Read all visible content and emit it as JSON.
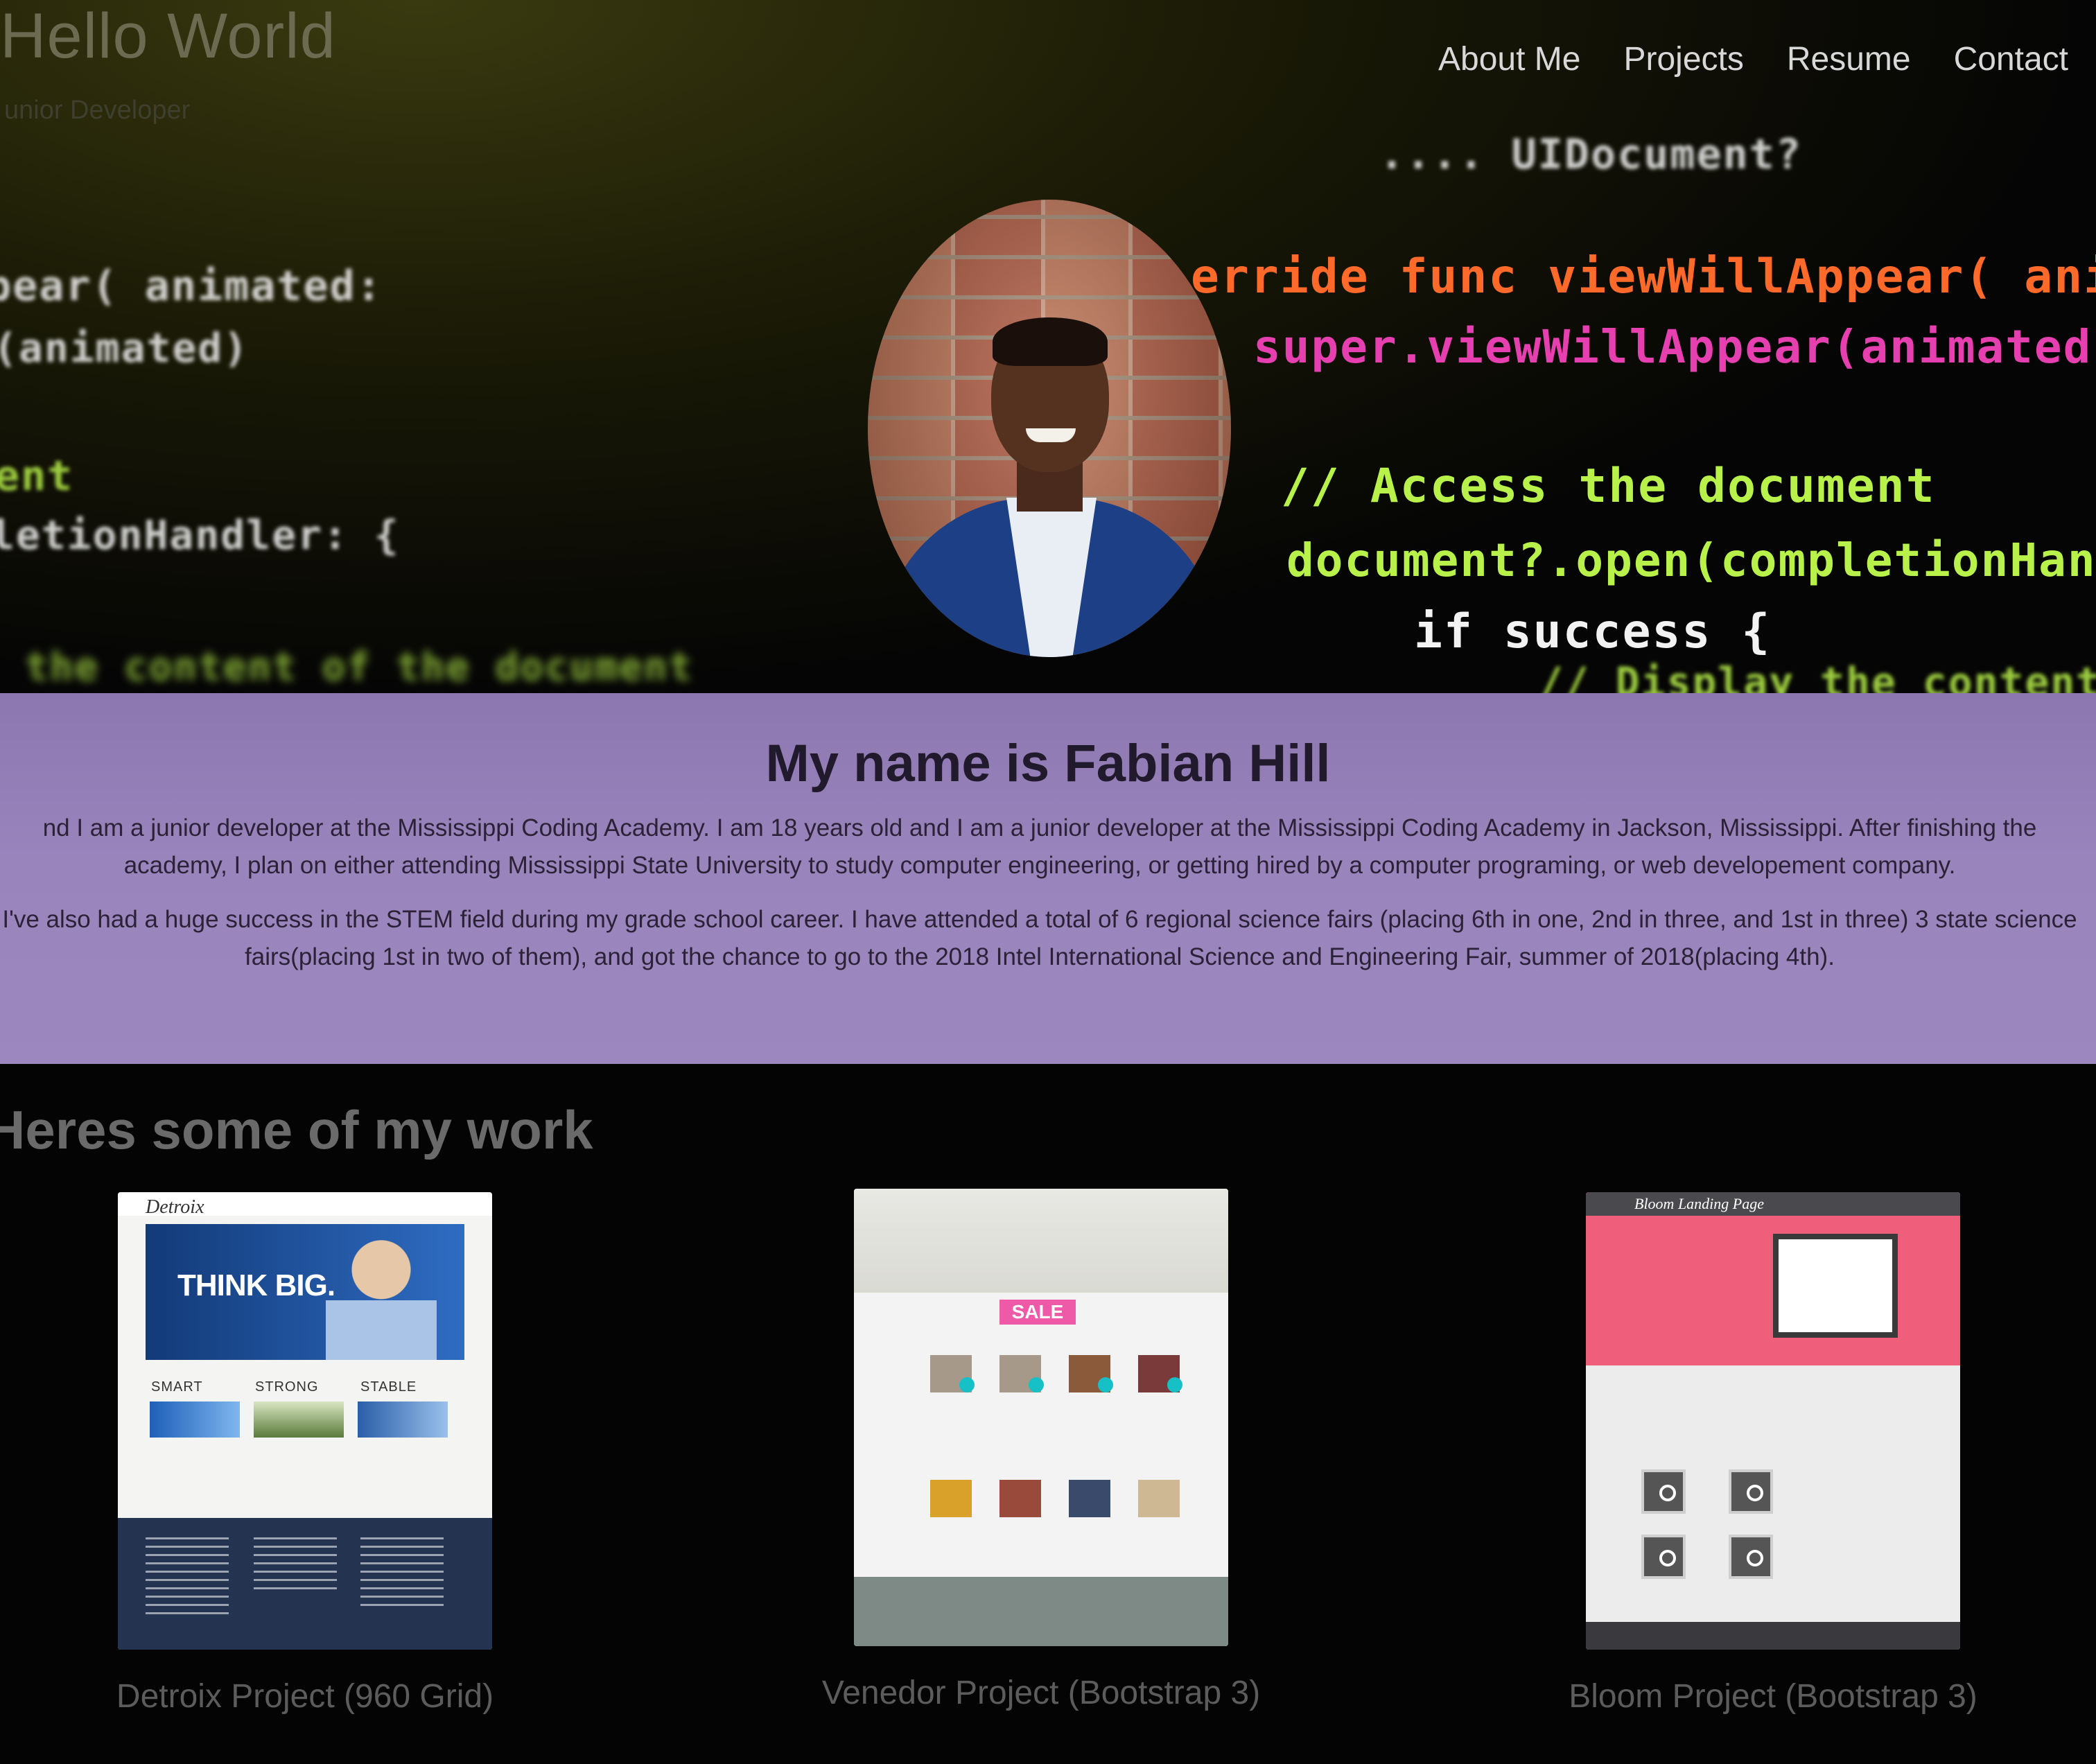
{
  "header": {
    "title": "Hello World",
    "subtitle": "unior Developer"
  },
  "nav": {
    "items": [
      {
        "label": "About Me"
      },
      {
        "label": "Projects"
      },
      {
        "label": "Resume"
      },
      {
        "label": "Contact"
      }
    ]
  },
  "hero": {
    "code_lines": [
      "....  UIDocument?",
      "pear(   animated:",
      "(animated)",
      "erride func viewWillAppear(   animated:",
      "super.viewWillAppear(animated)",
      "ent",
      "letionHandler: {",
      "// Access the document",
      "document?.open(completionHandler:",
      "if success {",
      "the content of the document",
      "// Display the content of"
    ]
  },
  "about": {
    "title": "My name is Fabian Hill",
    "paragraph1": "nd I am a junior developer at the Mississippi Coding Academy. I am 18 years old and I am a junior developer at the Mississippi Coding Academy in Jackson, Mississippi. After finishing the academy, I plan on either attending Mississippi State University to study computer engineering, or getting hired by a computer programing, or web developement company.",
    "paragraph2": "I've also had a huge success in the STEM field during my grade school career. I have attended a total of 6 regional science fairs (placing 6th in one, 2nd in three, and 1st in three) 3 state science fairs(placing 1st in two of them), and got the chance to go to the 2018 Intel International Science and Engineering Fair, summer of 2018(placing 4th)."
  },
  "work": {
    "title": "Heres some of my work",
    "projects": [
      {
        "caption": "Detroix Project (960 Grid)",
        "mock": {
          "logo": "Detroix",
          "headline": "THINK BIG.",
          "labels": [
            "SMART",
            "STRONG",
            "STABLE"
          ]
        }
      },
      {
        "caption": "Venedor Project (Bootstrap 3)",
        "mock": {
          "badge": "SALE"
        }
      },
      {
        "caption": "Bloom Project (Bootstrap 3)",
        "mock": {
          "logo": "Bloom Landing Page"
        }
      }
    ]
  },
  "colors": {
    "about_background": "#9a84bc",
    "nav_text": "#d8d8d8",
    "code_pink": "#e63fb0",
    "code_lime": "#b8f14a",
    "code_orange": "#ff6a2a",
    "code_blue": "#4aa9ff"
  }
}
